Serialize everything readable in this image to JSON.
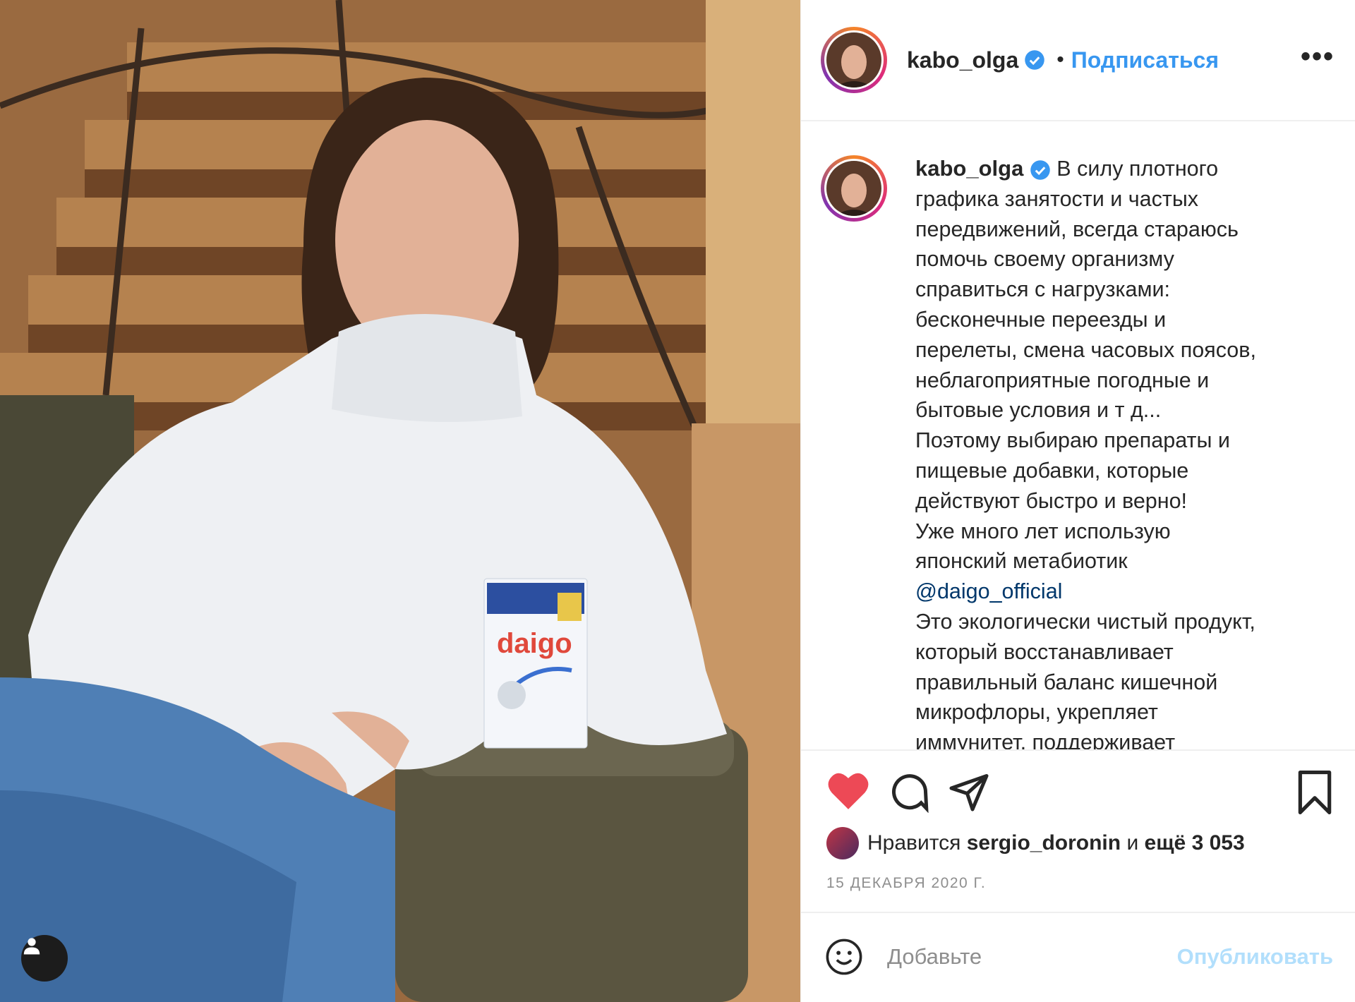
{
  "post": {
    "username": "kabo_olga",
    "verified": true,
    "header": {
      "follow_label": "Подписаться",
      "separator": "•",
      "more_label": "•••"
    },
    "caption_lines": [
      "графика занятости и частых",
      "передвижений, всегда стараюсь",
      "помочь своему организму",
      "справиться с нагрузками:",
      "бесконечные переезды и",
      "перелеты, смена часовых поясов,",
      "неблагоприятные погодные и",
      "бытовые условия и т д...",
      "Поэтому выбираю препараты и",
      "пищевые добавки, которые",
      "действуют быстро и верно!",
      "Уже много лет использую",
      "японский метабиотик"
    ],
    "caption_first": "В силу плотного",
    "mention": "@daigo_official",
    "caption_after": [
      "Это экологически чистый продукт,",
      "который восстанавливает",
      "правильный баланс кишечной",
      "микрофлоры, укрепляет",
      "иммунитет, поддерживает"
    ],
    "likes": {
      "prefix": "Нравится",
      "user": "sergio_doronin",
      "middle": "и",
      "count": "ещё 3 053"
    },
    "date": "15 ДЕКАБРЯ 2020 Г.",
    "comment": {
      "placeholder": "Добавьте",
      "publish_label": "Опубликовать"
    },
    "product_label": "daigo",
    "colors": {
      "accent": "#3897f0",
      "like": "#ed4956",
      "mention": "#00376b",
      "muted": "#8e8e8e"
    },
    "icons": [
      "heart-icon",
      "comment-icon",
      "share-icon",
      "bookmark-icon",
      "emoji-icon",
      "user-tag-icon",
      "verified-badge-icon",
      "more-icon"
    ]
  }
}
